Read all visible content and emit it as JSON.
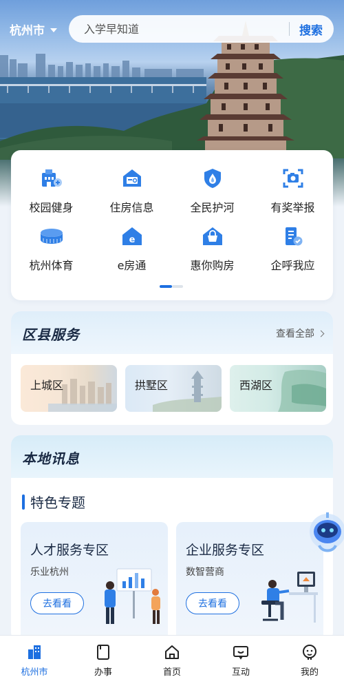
{
  "colors": {
    "accent": "#1d6fe0",
    "text": "#222222",
    "background": "#eef3f9"
  },
  "header": {
    "city": "杭州市",
    "search_placeholder": "入学早知道",
    "search_button": "搜索"
  },
  "services": {
    "items": [
      {
        "label": "校园健身",
        "icon": "campus-fitness-icon"
      },
      {
        "label": "住房信息",
        "icon": "housing-info-icon"
      },
      {
        "label": "全民护河",
        "icon": "river-protection-icon"
      },
      {
        "label": "有奖举报",
        "icon": "reward-report-icon"
      },
      {
        "label": "杭州体育",
        "icon": "stadium-icon"
      },
      {
        "label": "e房通",
        "icon": "e-house-icon"
      },
      {
        "label": "惠你购房",
        "icon": "house-purchase-icon"
      },
      {
        "label": "企呼我应",
        "icon": "enterprise-request-icon"
      }
    ],
    "pager": {
      "pages": 2,
      "current": 1
    }
  },
  "district": {
    "title": "区县服务",
    "view_all": "查看全部",
    "items": [
      {
        "label": "上城区"
      },
      {
        "label": "拱墅区"
      },
      {
        "label": "西湖区"
      }
    ]
  },
  "news": {
    "title": "本地讯息",
    "topic_title": "特色专题",
    "topics": [
      {
        "title": "人才服务专区",
        "subtitle": "乐业杭州",
        "button": "去看看"
      },
      {
        "title": "企业服务专区",
        "subtitle": "数智营商",
        "button": "去看看"
      }
    ]
  },
  "bottom_nav": [
    {
      "label": "杭州市",
      "icon": "city-icon",
      "active": true
    },
    {
      "label": "办事",
      "icon": "affairs-icon",
      "active": false
    },
    {
      "label": "首页",
      "icon": "home-icon",
      "active": false
    },
    {
      "label": "互动",
      "icon": "interaction-icon",
      "active": false
    },
    {
      "label": "我的",
      "icon": "profile-icon",
      "active": false
    }
  ]
}
